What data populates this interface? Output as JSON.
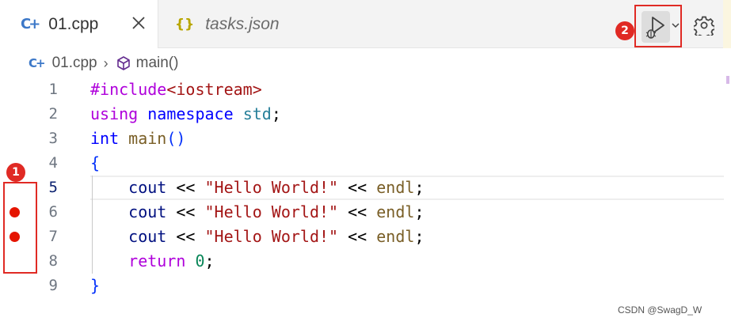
{
  "tabs": [
    {
      "icon": "C+",
      "label": "01.cpp",
      "active": true
    },
    {
      "icon": "{}",
      "label": "tasks.json",
      "active": false
    }
  ],
  "toolbar": {
    "badge": "2"
  },
  "breadcrumb": {
    "file_icon": "C+",
    "file": "01.cpp",
    "separator": "›",
    "symbol": "main()"
  },
  "gutter": {
    "badge": "1"
  },
  "lines": [
    {
      "n": "1",
      "tokens": [
        {
          "t": "#include",
          "c": "k-purple"
        },
        {
          "t": "<iostream>",
          "c": "k-str"
        }
      ]
    },
    {
      "n": "2",
      "tokens": [
        {
          "t": "using",
          "c": "k-purple"
        },
        {
          "t": " ",
          "c": "k-op"
        },
        {
          "t": "namespace",
          "c": "k-blue"
        },
        {
          "t": " ",
          "c": "k-op"
        },
        {
          "t": "std",
          "c": "k-teal"
        },
        {
          "t": ";",
          "c": "k-op"
        }
      ]
    },
    {
      "n": "3",
      "tokens": [
        {
          "t": "int",
          "c": "k-blue"
        },
        {
          "t": " ",
          "c": "k-op"
        },
        {
          "t": "main",
          "c": "k-func"
        },
        {
          "t": "()",
          "c": "k-brace"
        }
      ]
    },
    {
      "n": "4",
      "tokens": [
        {
          "t": "{",
          "c": "k-brace"
        }
      ]
    },
    {
      "n": "5",
      "current": true,
      "tokens": [
        {
          "t": "    ",
          "c": "k-op"
        },
        {
          "t": "cout",
          "c": "k-var"
        },
        {
          "t": " << ",
          "c": "k-op"
        },
        {
          "t": "\"Hello World!\"",
          "c": "k-str"
        },
        {
          "t": " << ",
          "c": "k-op"
        },
        {
          "t": "endl",
          "c": "k-func"
        },
        {
          "t": ";",
          "c": "k-op"
        }
      ]
    },
    {
      "n": "6",
      "breakpoint": true,
      "tokens": [
        {
          "t": "    ",
          "c": "k-op"
        },
        {
          "t": "cout",
          "c": "k-var"
        },
        {
          "t": " << ",
          "c": "k-op"
        },
        {
          "t": "\"Hello World!\"",
          "c": "k-str"
        },
        {
          "t": " << ",
          "c": "k-op"
        },
        {
          "t": "endl",
          "c": "k-func"
        },
        {
          "t": ";",
          "c": "k-op"
        }
      ]
    },
    {
      "n": "7",
      "breakpoint": true,
      "tokens": [
        {
          "t": "    ",
          "c": "k-op"
        },
        {
          "t": "cout",
          "c": "k-var"
        },
        {
          "t": " << ",
          "c": "k-op"
        },
        {
          "t": "\"Hello World!\"",
          "c": "k-str"
        },
        {
          "t": " << ",
          "c": "k-op"
        },
        {
          "t": "endl",
          "c": "k-func"
        },
        {
          "t": ";",
          "c": "k-op"
        }
      ]
    },
    {
      "n": "8",
      "tokens": [
        {
          "t": "    ",
          "c": "k-op"
        },
        {
          "t": "return",
          "c": "k-purple"
        },
        {
          "t": " ",
          "c": "k-op"
        },
        {
          "t": "0",
          "c": "k-num"
        },
        {
          "t": ";",
          "c": "k-op"
        }
      ]
    },
    {
      "n": "9",
      "tokens": [
        {
          "t": "}",
          "c": "k-brace"
        }
      ]
    }
  ],
  "watermark": "CSDN @SwagD_W"
}
